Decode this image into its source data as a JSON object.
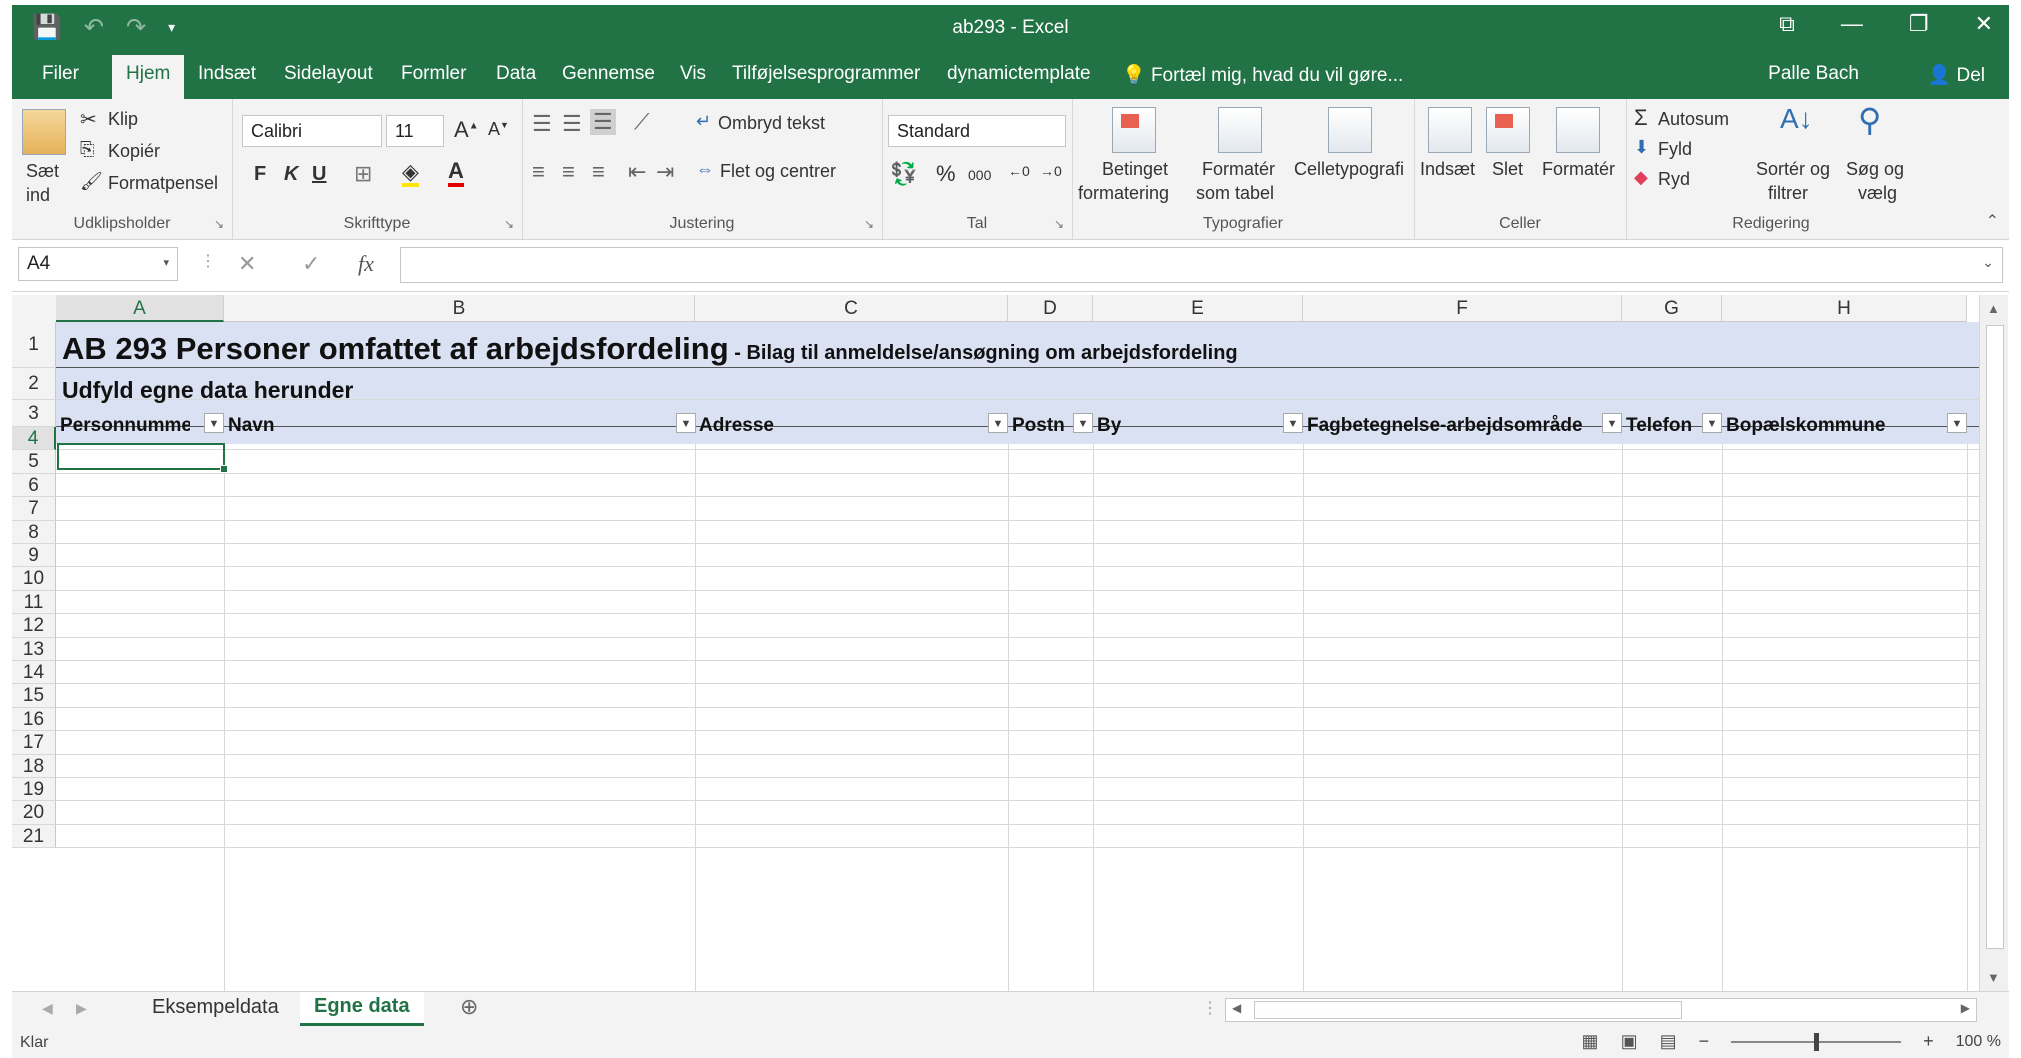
{
  "window": {
    "title": "ab293 - Excel",
    "accent": "#217346",
    "icons": [
      "save-icon",
      "undo-icon",
      "redo-icon",
      "customize-qat-icon",
      "ribbon-display-icon",
      "minimize-icon",
      "restore-icon",
      "close-icon"
    ]
  },
  "tabs": [
    "Filer",
    "Hjem",
    "Indsæt",
    "Sidelayout",
    "Formler",
    "Data",
    "Gennemse",
    "Vis",
    "Tilføjelsesprogrammer",
    "dynamictemplate"
  ],
  "active_tab": "Hjem",
  "tell_me": "Fortæl mig, hvad du vil gøre...",
  "user": "Palle Bach",
  "share": "Del",
  "ribbon": {
    "clipboard": {
      "paste": "Sæt",
      "paste2": "ind",
      "cut": "Klip",
      "copy": "Kopiér",
      "format_painter": "Formatpensel",
      "label": "Udklipsholder"
    },
    "font": {
      "name": "Calibri",
      "size": "11",
      "bold": "F",
      "italic": "K",
      "underline": "U",
      "label": "Skrifttype"
    },
    "alignment": {
      "wrap": "Ombryd tekst",
      "merge": "Flet og centrer",
      "label": "Justering"
    },
    "number": {
      "format": "Standard",
      "percent": "%",
      "thousands": "000",
      "label": "Tal"
    },
    "styles": {
      "cond1": "Betinget",
      "cond2": "formatering",
      "table1": "Formatér",
      "table2": "som tabel",
      "cell": "Celletypografi",
      "label": "Typografier"
    },
    "cells": {
      "insert": "Indsæt",
      "delete": "Slet",
      "format": "Formatér",
      "label": "Celler"
    },
    "editing": {
      "autosum": "Autosum",
      "fill": "Fyld",
      "clear": "Ryd",
      "sort1": "Sortér og",
      "sort2": "filtrer",
      "find1": "Søg og",
      "find2": "vælg",
      "label": "Redigering"
    }
  },
  "formula_bar": {
    "name_box": "A4",
    "fx": "fx",
    "value": ""
  },
  "grid": {
    "columns": [
      "A",
      "B",
      "C",
      "D",
      "E",
      "F",
      "G",
      "H"
    ],
    "selected_column": "A",
    "rows": [
      "1",
      "2",
      "3",
      "4",
      "5",
      "6",
      "7",
      "8",
      "9",
      "10",
      "11",
      "12",
      "13",
      "14",
      "15",
      "16",
      "17",
      "18",
      "19",
      "20",
      "21"
    ],
    "selected_row": "4",
    "title": "AB 293 Personer omfattet af arbejdsfordeling",
    "subtitle": " - Bilag til anmeldelse/ansøgning om arbejdsfordeling",
    "instruction": "Udfyld egne data herunder",
    "headers": [
      "Personnumme",
      "Navn",
      "Adresse",
      "Postn",
      "By",
      "Fagbetegnelse-arbejdsområde",
      "Telefon",
      "Bopælskommune"
    ],
    "band_color": "#d9e1f2"
  },
  "sheets": [
    "Eksempeldata",
    "Egne data"
  ],
  "active_sheet": "Egne data",
  "status": {
    "ready": "Klar",
    "zoom": "100 %"
  }
}
